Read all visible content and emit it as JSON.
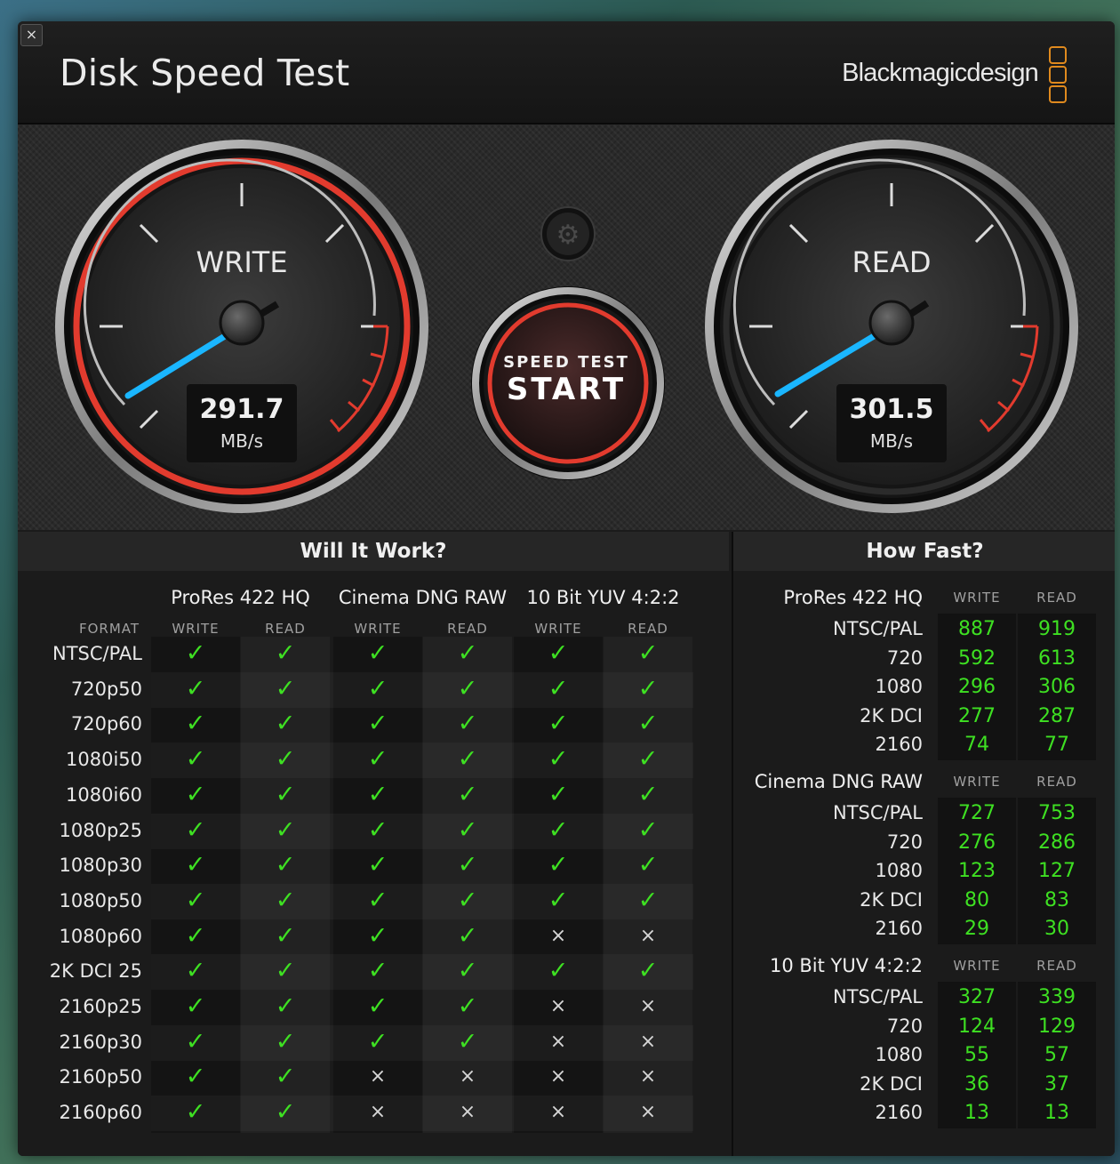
{
  "window": {
    "title": "Disk Speed Test",
    "brand": "Blackmagicdesign",
    "close_icon": "×"
  },
  "gauges": {
    "write": {
      "label": "WRITE",
      "value": "291.7",
      "unit": "MB/s",
      "color": "#e23b2e"
    },
    "read": {
      "label": "READ",
      "value": "301.5",
      "unit": "MB/s"
    },
    "start": {
      "top": "SPEED TEST",
      "main": "START"
    },
    "settings_icon": "⚙"
  },
  "will_it_work": {
    "title": "Will It Work?",
    "format_header": "FORMAT",
    "groups": [
      {
        "name": "ProRes 422 HQ",
        "write": "WRITE",
        "read": "READ"
      },
      {
        "name": "Cinema DNG RAW",
        "write": "WRITE",
        "read": "READ"
      },
      {
        "name": "10 Bit YUV 4:2:2",
        "write": "WRITE",
        "read": "READ"
      }
    ],
    "check_symbol": "✓",
    "cross_symbol": "×",
    "rows": [
      {
        "format": "NTSC/PAL",
        "cells": [
          1,
          1,
          1,
          1,
          1,
          1
        ]
      },
      {
        "format": "720p50",
        "cells": [
          1,
          1,
          1,
          1,
          1,
          1
        ]
      },
      {
        "format": "720p60",
        "cells": [
          1,
          1,
          1,
          1,
          1,
          1
        ]
      },
      {
        "format": "1080i50",
        "cells": [
          1,
          1,
          1,
          1,
          1,
          1
        ]
      },
      {
        "format": "1080i60",
        "cells": [
          1,
          1,
          1,
          1,
          1,
          1
        ]
      },
      {
        "format": "1080p25",
        "cells": [
          1,
          1,
          1,
          1,
          1,
          1
        ]
      },
      {
        "format": "1080p30",
        "cells": [
          1,
          1,
          1,
          1,
          1,
          1
        ]
      },
      {
        "format": "1080p50",
        "cells": [
          1,
          1,
          1,
          1,
          1,
          1
        ]
      },
      {
        "format": "1080p60",
        "cells": [
          1,
          1,
          1,
          1,
          0,
          0
        ]
      },
      {
        "format": "2K DCI 25",
        "cells": [
          1,
          1,
          1,
          1,
          1,
          1
        ]
      },
      {
        "format": "2160p25",
        "cells": [
          1,
          1,
          1,
          1,
          0,
          0
        ]
      },
      {
        "format": "2160p30",
        "cells": [
          1,
          1,
          1,
          1,
          0,
          0
        ]
      },
      {
        "format": "2160p50",
        "cells": [
          1,
          1,
          0,
          0,
          0,
          0
        ]
      },
      {
        "format": "2160p60",
        "cells": [
          1,
          1,
          0,
          0,
          0,
          0
        ]
      }
    ]
  },
  "how_fast": {
    "title": "How Fast?",
    "groups": [
      {
        "name": "ProRes 422 HQ",
        "write": "WRITE",
        "read": "READ",
        "rows": [
          {
            "label": "NTSC/PAL",
            "write": "887",
            "read": "919"
          },
          {
            "label": "720",
            "write": "592",
            "read": "613"
          },
          {
            "label": "1080",
            "write": "296",
            "read": "306"
          },
          {
            "label": "2K DCI",
            "write": "277",
            "read": "287"
          },
          {
            "label": "2160",
            "write": "74",
            "read": "77"
          }
        ]
      },
      {
        "name": "Cinema DNG RAW",
        "write": "WRITE",
        "read": "READ",
        "rows": [
          {
            "label": "NTSC/PAL",
            "write": "727",
            "read": "753"
          },
          {
            "label": "720",
            "write": "276",
            "read": "286"
          },
          {
            "label": "1080",
            "write": "123",
            "read": "127"
          },
          {
            "label": "2K DCI",
            "write": "80",
            "read": "83"
          },
          {
            "label": "2160",
            "write": "29",
            "read": "30"
          }
        ]
      },
      {
        "name": "10 Bit YUV 4:2:2",
        "write": "WRITE",
        "read": "READ",
        "rows": [
          {
            "label": "NTSC/PAL",
            "write": "327",
            "read": "339"
          },
          {
            "label": "720",
            "write": "124",
            "read": "129"
          },
          {
            "label": "1080",
            "write": "55",
            "read": "57"
          },
          {
            "label": "2K DCI",
            "write": "36",
            "read": "37"
          },
          {
            "label": "2160",
            "write": "13",
            "read": "13"
          }
        ]
      }
    ]
  }
}
